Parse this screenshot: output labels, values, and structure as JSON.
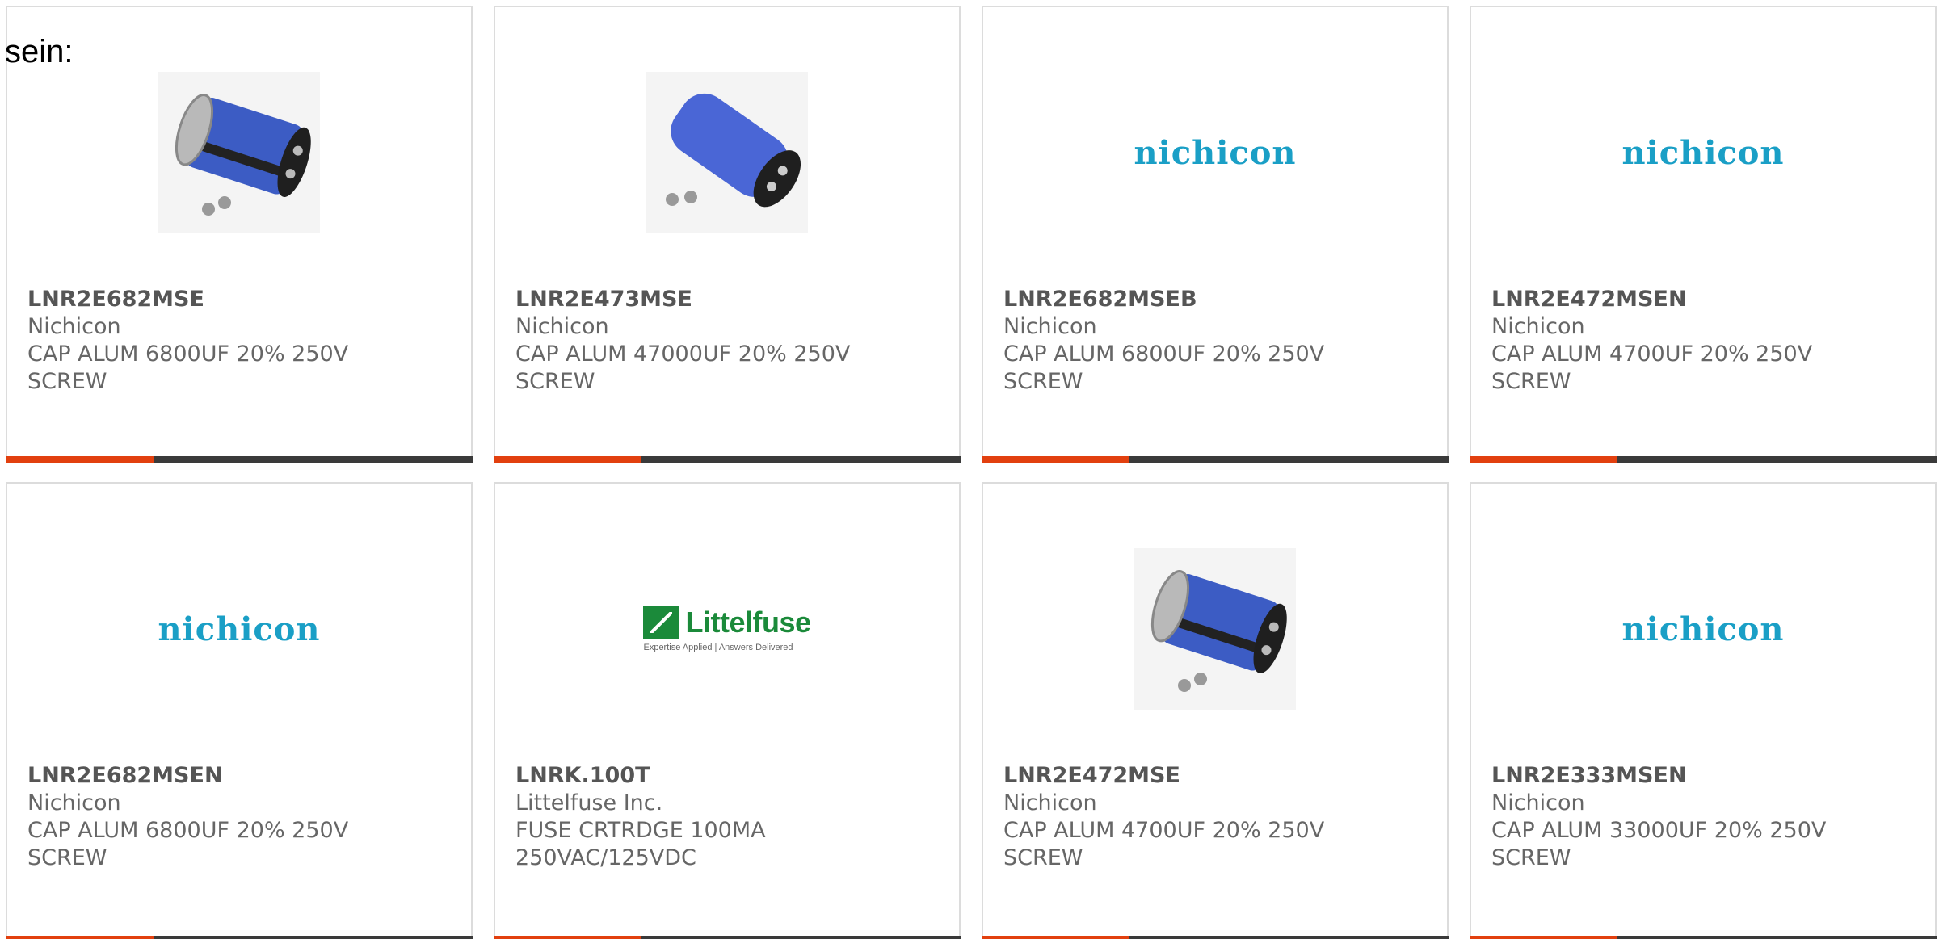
{
  "intro_text": "sein:",
  "colors": {
    "accent": "#e2400f",
    "bar_dark": "#3a3a3a",
    "nichicon_blue": "#1a9fc6",
    "littelfuse_green": "#1b8a3a"
  },
  "products": [
    {
      "part_number": "LNR2E682MSE",
      "manufacturer": "Nichicon",
      "description": "CAP ALUM 6800UF 20% 250V\nSCREW",
      "image": "capacitor-photo-icon"
    },
    {
      "part_number": "LNR2E473MSE",
      "manufacturer": "Nichicon",
      "description": "CAP ALUM 47000UF 20% 250V\nSCREW",
      "image": "capacitor-photo-icon"
    },
    {
      "part_number": "LNR2E682MSEB",
      "manufacturer": "Nichicon",
      "description": "CAP ALUM 6800UF 20% 250V\nSCREW",
      "image": "nichicon-logo",
      "logo_text": "nichicon"
    },
    {
      "part_number": "LNR2E472MSEN",
      "manufacturer": "Nichicon",
      "description": "CAP ALUM 4700UF 20% 250V\nSCREW",
      "image": "nichicon-logo",
      "logo_text": "nichicon"
    },
    {
      "part_number": "LNR2E682MSEN",
      "manufacturer": "Nichicon",
      "description": "CAP ALUM 6800UF 20% 250V\nSCREW",
      "image": "nichicon-logo",
      "logo_text": "nichicon"
    },
    {
      "part_number": "LNRK.100T",
      "manufacturer": "Littelfuse Inc.",
      "description": "FUSE CRTRDGE 100MA\n250VAC/125VDC",
      "image": "littelfuse-logo",
      "logo_text": "Littelfuse",
      "logo_tagline": "Expertise Applied | Answers Delivered"
    },
    {
      "part_number": "LNR2E472MSE",
      "manufacturer": "Nichicon",
      "description": "CAP ALUM 4700UF 20% 250V\nSCREW",
      "image": "capacitor-photo-icon"
    },
    {
      "part_number": "LNR2E333MSEN",
      "manufacturer": "Nichicon",
      "description": "CAP ALUM 33000UF 20% 250V\nSCREW",
      "image": "nichicon-logo",
      "logo_text": "nichicon"
    }
  ]
}
